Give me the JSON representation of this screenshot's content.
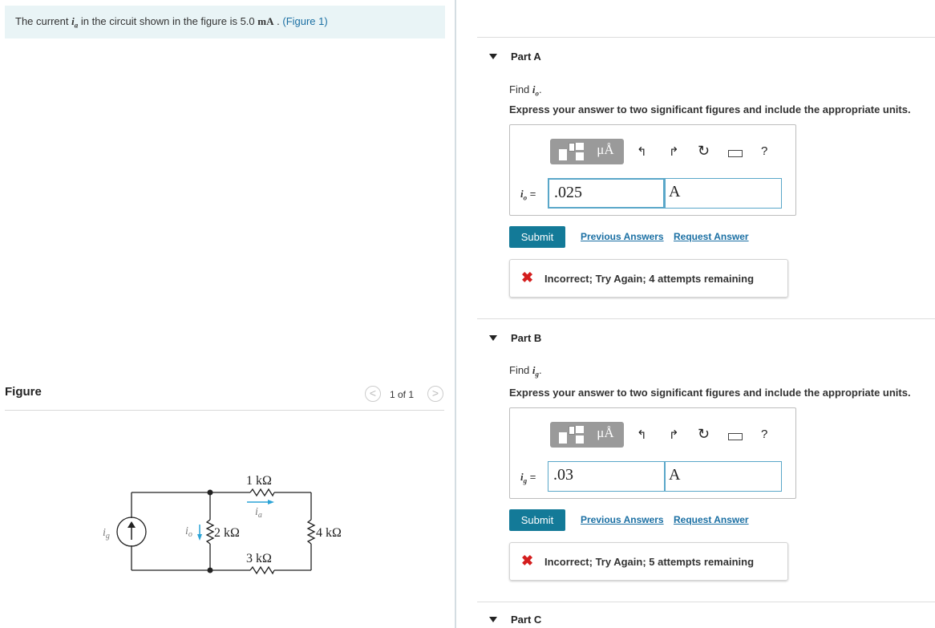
{
  "intro": {
    "prefix": "The current",
    "var": "i",
    "var_sub": "a",
    "middle": "in the circuit shown in the figure is 5.0",
    "unit": "mA",
    "sep": ".",
    "figure_link": "(Figure 1)"
  },
  "figure": {
    "label": "Figure",
    "pager": "1 of 1",
    "prev": "<",
    "next": ">",
    "circuit": {
      "r_top": "1 kΩ",
      "r_left": "2 kΩ",
      "r_right": "4 kΩ",
      "r_bottom": "3 kΩ",
      "src_label": "i",
      "src_sub": "g",
      "io_label": "i",
      "io_sub": "o",
      "ia_label": "i",
      "ia_sub": "a"
    }
  },
  "parts": [
    {
      "title": "Part A",
      "find_prefix": "Find ",
      "find_var": "i",
      "find_sub": "o",
      "find_suffix": ".",
      "express": "Express your answer to two significant figures and include the appropriate units.",
      "answer_var": "i",
      "answer_sub": "o",
      "answer_eq": " =",
      "value": ".025",
      "unit": "A",
      "submit": "Submit",
      "prev_answers": "Previous Answers",
      "request_answer": "Request Answer",
      "feedback": "Incorrect; Try Again; 4 attempts remaining"
    },
    {
      "title": "Part B",
      "find_prefix": "Find ",
      "find_var": "i",
      "find_sub": "g",
      "find_suffix": ".",
      "express": "Express your answer to two significant figures and include the appropriate units.",
      "answer_var": "i",
      "answer_sub": "g",
      "answer_eq": " =",
      "value": ".03",
      "unit": "A",
      "submit": "Submit",
      "prev_answers": "Previous Answers",
      "request_answer": "Request Answer",
      "feedback": "Incorrect; Try Again; 5 attempts remaining"
    },
    {
      "title": "Part C"
    }
  ],
  "toolbar": {
    "units_label": "μÅ",
    "help": "?",
    "icons": [
      "templates-icon",
      "units-icon",
      "undo-icon",
      "redo-icon",
      "reset-icon",
      "keyboard-icon",
      "help-icon"
    ]
  },
  "colors": {
    "accent": "#137a98",
    "link": "#1a6fa3",
    "error": "#d41e1e",
    "intro_bg": "#e9f4f6"
  }
}
